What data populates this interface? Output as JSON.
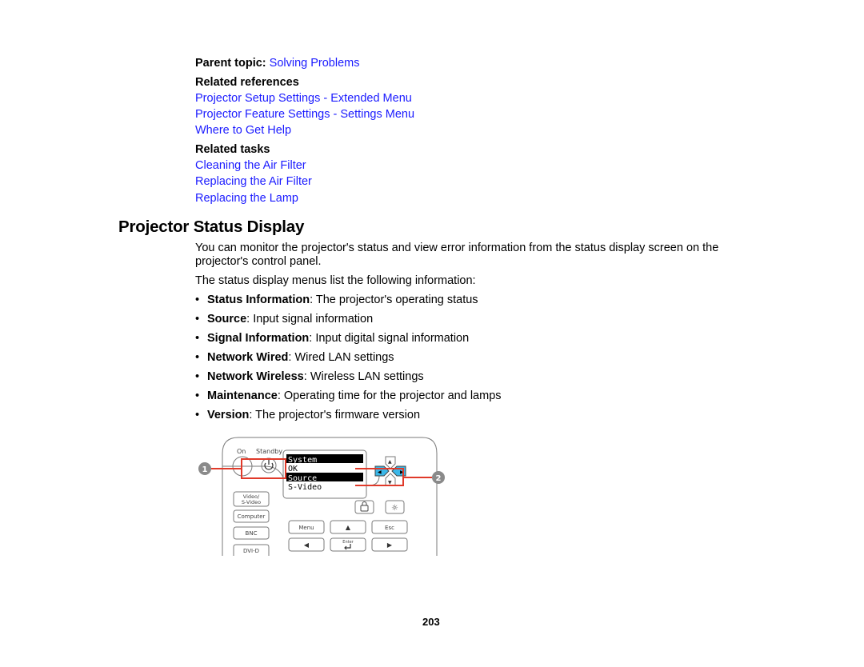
{
  "parent_topic": {
    "label": "Parent topic:",
    "link": "Solving Problems"
  },
  "related_references": {
    "heading": "Related references",
    "links": [
      "Projector Setup Settings - Extended Menu",
      "Projector Feature Settings - Settings Menu",
      "Where to Get Help"
    ]
  },
  "related_tasks": {
    "heading": "Related tasks",
    "links": [
      "Cleaning the Air Filter",
      "Replacing the Air Filter",
      "Replacing the Lamp"
    ]
  },
  "section": {
    "title": "Projector Status Display",
    "intro": "You can monitor the projector's status and view error information from the status display screen on the projector's control panel.",
    "list_intro": "The status display menus list the following information:",
    "bullet_glyph": "•",
    "items": [
      {
        "term": "Status Information",
        "desc": ": The projector's operating status"
      },
      {
        "term": "Source",
        "desc": ": Input signal information"
      },
      {
        "term": "Signal Information",
        "desc": ": Input digital signal information"
      },
      {
        "term": "Network Wired",
        "desc": ": Wired LAN settings"
      },
      {
        "term": "Network Wireless",
        "desc": ": Wireless LAN settings"
      },
      {
        "term": "Maintenance",
        "desc": ": Operating time for the projector and lamps"
      },
      {
        "term": "Version",
        "desc": ": The projector's firmware version"
      }
    ]
  },
  "figure": {
    "callouts": [
      "1",
      "2"
    ],
    "panel_labels": {
      "on": "On",
      "standby": "Standby"
    },
    "lcd_lines": [
      {
        "text": "System",
        "highlighted": true
      },
      {
        "text": "OK",
        "highlighted": false
      },
      {
        "text": "Source",
        "highlighted": true
      },
      {
        "text": "S-Video",
        "highlighted": false
      }
    ],
    "source_buttons": [
      "Video/",
      "S-Video",
      "Computer",
      "BNC",
      "DVI-D"
    ],
    "control_buttons": {
      "menu": "Menu",
      "esc": "Esc",
      "enter": "Enter",
      "up": "▲",
      "left": "◀",
      "right": "▶"
    },
    "colors": {
      "callout_line": "#e03a2a",
      "callout_badge": "#8a8a8a",
      "nav_highlight": "#3ab7e8",
      "panel_stroke": "#7a7a7a"
    }
  },
  "page_number": "203"
}
